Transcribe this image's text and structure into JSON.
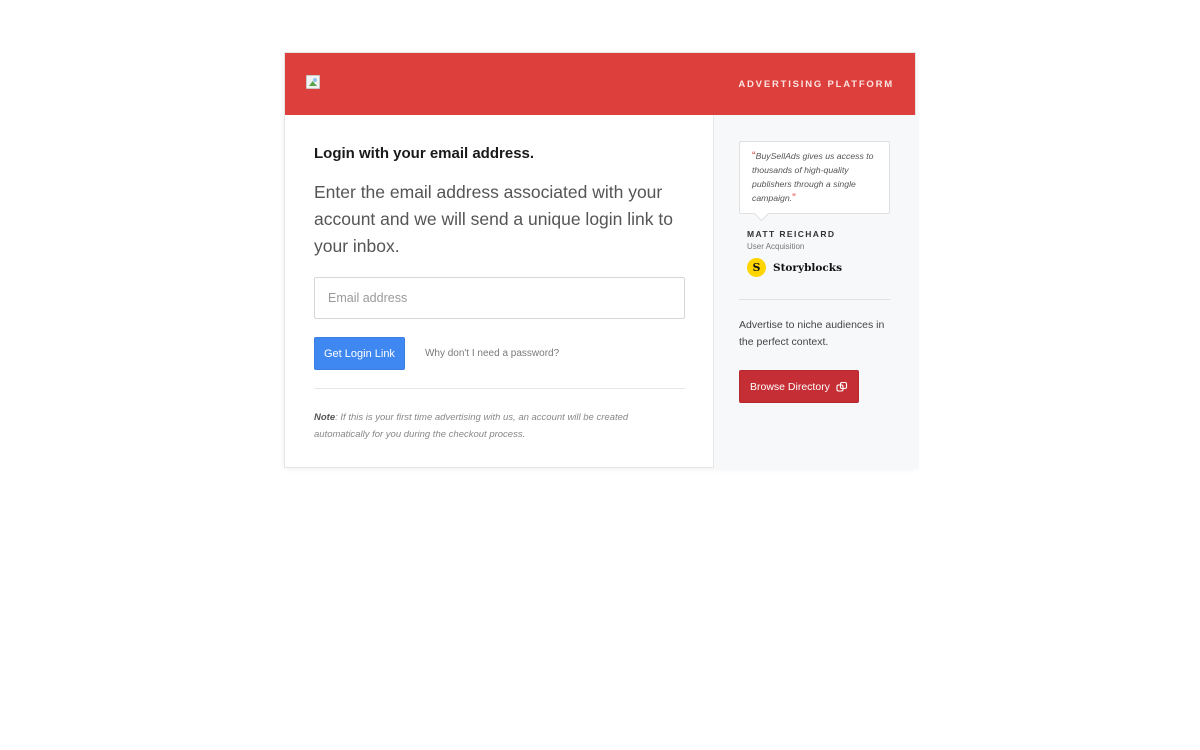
{
  "header": {
    "platform_label": "ADVERTISING PLATFORM"
  },
  "login": {
    "heading": "Login with your email address.",
    "description": "Enter the email address associated with your account and we will send a unique login link to your inbox.",
    "email_placeholder": "Email address",
    "email_value": "",
    "button_label": "Get Login Link",
    "help_link": "Why don't I need a password?",
    "note_label": "Note",
    "note_text": ": If this is your first time advertising with us, an account will be created automatically for you during the checkout process."
  },
  "sidebar": {
    "quote_open": "“",
    "quote": "BuySellAds gives us access to thousands of high-quality publishers through a single campaign.",
    "quote_close": "”",
    "author_name": "MATT REICHARD",
    "author_role": "User Acquisition",
    "brand_icon_letter": "S",
    "brand_name": "Storyblocks",
    "advertise_text": "Advertise to niche audiences in the perfect context.",
    "browse_button": "Browse Directory"
  },
  "colors": {
    "header_red": "#dd403c",
    "login_button_blue": "#3f87f1",
    "browse_button_red": "#c42e34",
    "brand_yellow": "#ffd500"
  },
  "icons": {
    "logo": "broken-image-icon",
    "browse": "external-link-icon"
  }
}
